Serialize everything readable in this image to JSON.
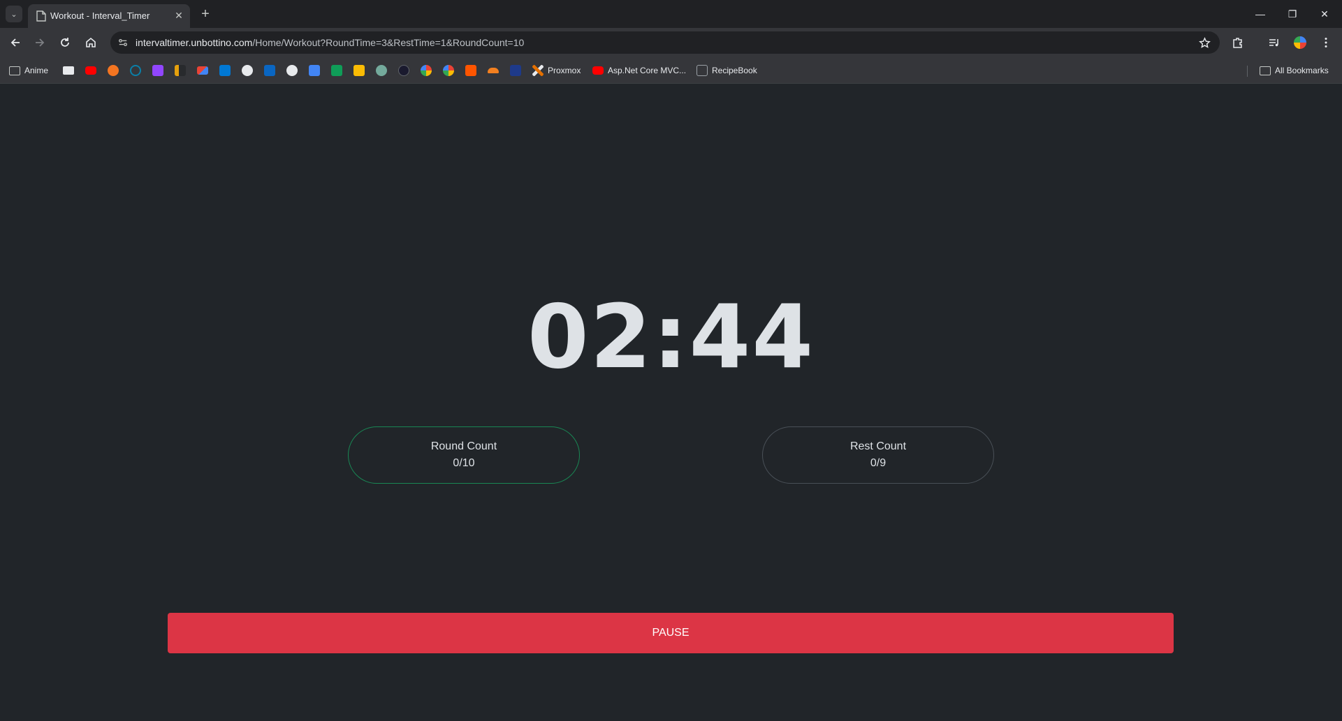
{
  "browser": {
    "tab": {
      "title": "Workout - Interval_Timer"
    },
    "url": {
      "host": "intervaltimer.unbottino.com",
      "path": "/Home/Workout?RoundTime=3&RestTime=1&RoundCount=10"
    },
    "bookmarks": [
      {
        "label": "Anime",
        "icon": "folder-icon",
        "color": ""
      },
      {
        "label": "",
        "icon": "stack-icon",
        "color": "#e8eaed"
      },
      {
        "label": "",
        "icon": "youtube-icon",
        "color": "#ff0000"
      },
      {
        "label": "",
        "icon": "crunchyroll-icon",
        "color": "#f47521"
      },
      {
        "label": "",
        "icon": "disney-icon",
        "color": "#0a7fa8"
      },
      {
        "label": "",
        "icon": "twitch-icon",
        "color": "#9146ff"
      },
      {
        "label": "",
        "icon": "plex-icon",
        "color": "#e5a00d"
      },
      {
        "label": "",
        "icon": "gmail-icon",
        "color": "#ea4335"
      },
      {
        "label": "",
        "icon": "outlook-icon",
        "color": "#0078d4"
      },
      {
        "label": "",
        "icon": "github-icon",
        "color": "#e8eaed"
      },
      {
        "label": "",
        "icon": "linkedin-icon",
        "color": "#0a66c2"
      },
      {
        "label": "",
        "icon": "info-icon",
        "color": "#e8eaed"
      },
      {
        "label": "",
        "icon": "docs-icon",
        "color": "#4285f4"
      },
      {
        "label": "",
        "icon": "sheets-icon",
        "color": "#0f9d58"
      },
      {
        "label": "",
        "icon": "keep-icon",
        "color": "#fbbc04"
      },
      {
        "label": "",
        "icon": "chatgpt-icon",
        "color": "#74aa9c"
      },
      {
        "label": "",
        "icon": "app-icon",
        "color": "#1a1a2e"
      },
      {
        "label": "",
        "icon": "google-icon",
        "color": "#4285f4"
      },
      {
        "label": "",
        "icon": "google-icon",
        "color": "#34a853"
      },
      {
        "label": "",
        "icon": "soundcloud-icon",
        "color": "#ff5500"
      },
      {
        "label": "",
        "icon": "cloudflare-icon",
        "color": "#f38020"
      },
      {
        "label": "",
        "icon": "azure-icon",
        "color": "#1e3a8a"
      },
      {
        "label": "Proxmox",
        "icon": "proxmox-icon",
        "color": "#e57000"
      },
      {
        "label": "Asp.Net Core MVC...",
        "icon": "youtube-icon",
        "color": "#ff0000"
      },
      {
        "label": "RecipeBook",
        "icon": "recipebook-icon",
        "color": "#9aa0a6"
      }
    ],
    "all_bookmarks_label": "All Bookmarks"
  },
  "workout": {
    "timer": "02:44",
    "round": {
      "label": "Round Count",
      "value": "0/10"
    },
    "rest": {
      "label": "Rest Count",
      "value": "0/9"
    },
    "pause_label": "PAUSE"
  },
  "colors": {
    "page_bg": "#212529",
    "pause": "#dc3545",
    "round_border": "#198754",
    "rest_border": "#495057"
  }
}
